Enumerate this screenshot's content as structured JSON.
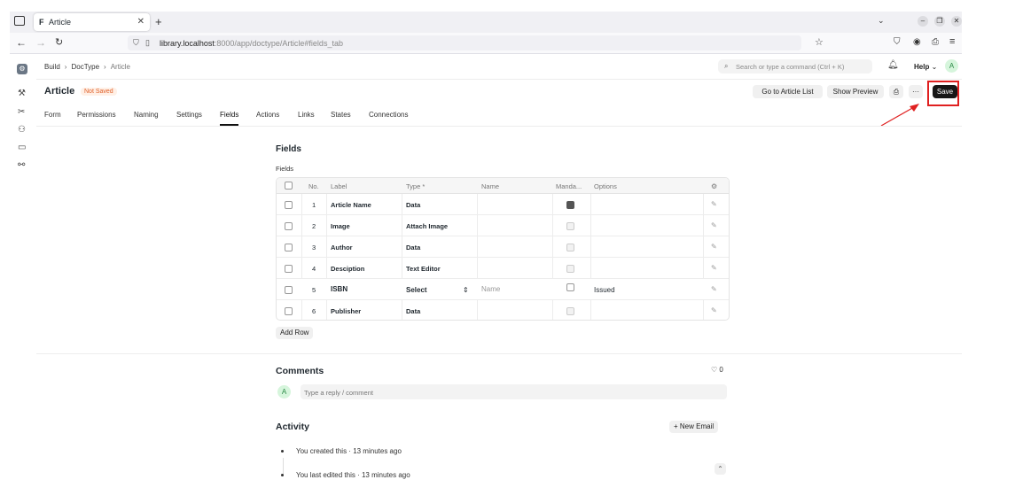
{
  "browser": {
    "tab_title": "Article",
    "tab_favicon": "F",
    "url_host": "library.localhost",
    "url_rest": ":8000/app/doctype/Article#fields_tab"
  },
  "topbar": {
    "breadcrumb": [
      "Build",
      "DocType",
      "Article"
    ],
    "search_placeholder": "Search or type a command (Ctrl + K)",
    "help_label": "Help",
    "avatar_letter": "A"
  },
  "page": {
    "title": "Article",
    "status_badge": "Not Saved",
    "buttons": {
      "go_to_list": "Go to Article List",
      "show_preview": "Show Preview",
      "more": "···",
      "save": "Save"
    }
  },
  "tabs": [
    "Form",
    "Permissions",
    "Naming",
    "Settings",
    "Fields",
    "Actions",
    "Links",
    "States",
    "Connections"
  ],
  "active_tab": "Fields",
  "fields_section": {
    "heading": "Fields",
    "grid_label": "Fields",
    "columns": [
      "No.",
      "Label",
      "Type *",
      "Name",
      "Manda...",
      "Options"
    ],
    "rows": [
      {
        "no": "1",
        "label": "Article Name",
        "type": "Data",
        "name": "",
        "mandatory": true,
        "options": ""
      },
      {
        "no": "2",
        "label": "Image",
        "type": "Attach Image",
        "name": "",
        "mandatory": false,
        "options": ""
      },
      {
        "no": "3",
        "label": "Author",
        "type": "Data",
        "name": "",
        "mandatory": false,
        "options": ""
      },
      {
        "no": "4",
        "label": "Desciption",
        "type": "Text Editor",
        "name": "",
        "mandatory": false,
        "options": ""
      },
      {
        "no": "5",
        "label": "ISBN",
        "type": "Select",
        "name": "Name",
        "mandatory": false,
        "options": "Issued"
      },
      {
        "no": "6",
        "label": "Publisher",
        "type": "Data",
        "name": "",
        "mandatory": false,
        "options": ""
      }
    ],
    "add_row": "Add Row"
  },
  "comments": {
    "heading": "Comments",
    "like_count": "0",
    "avatar_letter": "A",
    "placeholder": "Type a reply / comment"
  },
  "activity": {
    "heading": "Activity",
    "new_email": "+ New Email",
    "items": [
      "You created this · 13 minutes ago",
      "You last edited this · 13 minutes ago"
    ]
  },
  "icons": {
    "sidebar": [
      "app-logo-icon",
      "wrench-icon",
      "tools-icon",
      "users-icon",
      "window-icon",
      "integrations-icon"
    ]
  },
  "colors": {
    "highlight": "#e02020",
    "save_button": "#171717",
    "badge_text": "#e0602a"
  }
}
